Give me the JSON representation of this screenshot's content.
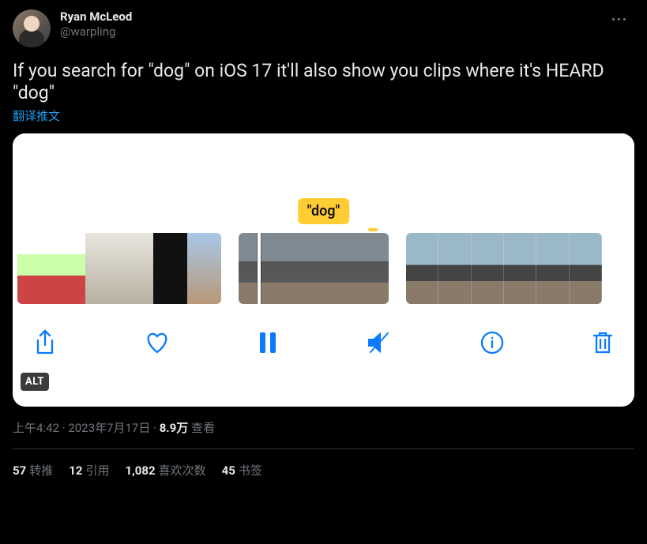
{
  "author": {
    "display_name": "Ryan McLeod",
    "handle": "@warpling"
  },
  "tweet_text": "If you search for \"dog\" on iOS 17 it'll also show you clips where it's HEARD \"dog\"",
  "translate": "翻译推文",
  "bubble": "\"dog\"",
  "alt_badge": "ALT",
  "meta": {
    "time": "上午4:42",
    "sep1": " · ",
    "date": "2023年7月17日",
    "sep2": " · ",
    "views_num": "8.9万",
    "views_label": " 查看"
  },
  "stats": {
    "retweet_num": "57",
    "retweet_label": "转推",
    "quote_num": "12",
    "quote_label": "引用",
    "like_num": "1,082",
    "like_label": "喜欢次数",
    "bookmark_num": "45",
    "bookmark_label": "书签"
  }
}
